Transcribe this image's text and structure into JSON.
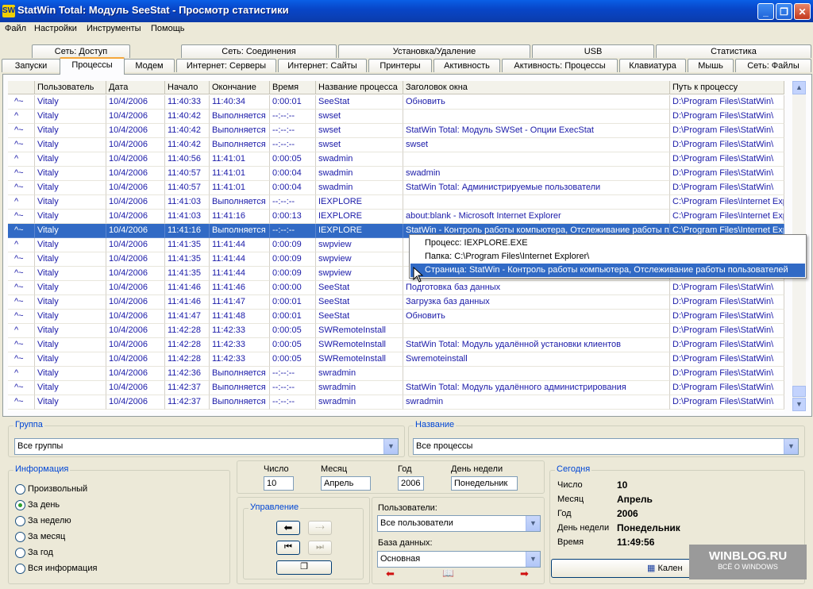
{
  "window": {
    "icon_text": "SW",
    "title": "StatWin Total: Модуль SeeStat - Просмотр статистики",
    "minimize": "_",
    "maximize": "❐",
    "close": "✕"
  },
  "menu": [
    "Файл",
    "Настройки",
    "Инструменты",
    "Помощь"
  ],
  "tabs_top": [
    "Сеть: Доступ",
    "Сеть: Соединения",
    "Установка/Удаление",
    "USB",
    "Статистика"
  ],
  "tabs_bottom": [
    "Запуски",
    "Процессы",
    "Модем",
    "Интернет: Серверы",
    "Интернет: Сайты",
    "Принтеры",
    "Активность",
    "Активность: Процессы",
    "Клавиатура",
    "Мышь",
    "Сеть: Файлы"
  ],
  "grid": {
    "columns": [
      "",
      "Пользователь",
      "Дата",
      "Начало",
      "Окончание",
      "Время",
      "Название процесса",
      "Заголовок окна",
      "Путь к процессу"
    ],
    "rows": [
      [
        "^~",
        "Vitaly",
        "10/4/2006",
        "11:40:33",
        "11:40:34",
        "0:00:01",
        "SeeStat",
        "Обновить",
        "D:\\Program Files\\StatWin\\"
      ],
      [
        "^",
        "Vitaly",
        "10/4/2006",
        "11:40:42",
        "Выполняется",
        "--:--:--",
        "swset",
        "",
        "D:\\Program Files\\StatWin\\"
      ],
      [
        "^~",
        "Vitaly",
        "10/4/2006",
        "11:40:42",
        "Выполняется",
        "--:--:--",
        "swset",
        "StatWin Total: Модуль SWSet - Опции ExecStat",
        "D:\\Program Files\\StatWin\\"
      ],
      [
        "^~",
        "Vitaly",
        "10/4/2006",
        "11:40:42",
        "Выполняется",
        "--:--:--",
        "swset",
        "swset",
        "D:\\Program Files\\StatWin\\"
      ],
      [
        "^",
        "Vitaly",
        "10/4/2006",
        "11:40:56",
        "11:41:01",
        "0:00:05",
        "swadmin",
        "",
        "D:\\Program Files\\StatWin\\"
      ],
      [
        "^~",
        "Vitaly",
        "10/4/2006",
        "11:40:57",
        "11:41:01",
        "0:00:04",
        "swadmin",
        "swadmin",
        "D:\\Program Files\\StatWin\\"
      ],
      [
        "^~",
        "Vitaly",
        "10/4/2006",
        "11:40:57",
        "11:41:01",
        "0:00:04",
        "swadmin",
        "StatWin Total: Администрируемые пользователи",
        "D:\\Program Files\\StatWin\\"
      ],
      [
        "^",
        "Vitaly",
        "10/4/2006",
        "11:41:03",
        "Выполняется",
        "--:--:--",
        "IEXPLORE",
        "",
        "C:\\Program Files\\Internet Expl"
      ],
      [
        "^~",
        "Vitaly",
        "10/4/2006",
        "11:41:03",
        "11:41:16",
        "0:00:13",
        "IEXPLORE",
        "about:blank - Microsoft Internet Explorer",
        "C:\\Program Files\\Internet Expl"
      ],
      [
        "^~",
        "Vitaly",
        "10/4/2006",
        "11:41:16",
        "Выполняется",
        "--:--:--",
        "IEXPLORE",
        "StatWin - Контроль работы компьютера, Отслеживание работы п",
        "C:\\Program Files\\Internet Expl"
      ],
      [
        "^",
        "Vitaly",
        "10/4/2006",
        "11:41:35",
        "11:41:44",
        "0:00:09",
        "swpview",
        "",
        "D:\\Program Files\\StatWin\\"
      ],
      [
        "^~",
        "Vitaly",
        "10/4/2006",
        "11:41:35",
        "11:41:44",
        "0:00:09",
        "swpview",
        "",
        "D:\\Program Files\\StatWin\\"
      ],
      [
        "^~",
        "Vitaly",
        "10/4/2006",
        "11:41:35",
        "11:41:44",
        "0:00:09",
        "swpview",
        "",
        "D:\\Program Files\\StatWin\\"
      ],
      [
        "^~",
        "Vitaly",
        "10/4/2006",
        "11:41:46",
        "11:41:46",
        "0:00:00",
        "SeeStat",
        "Подготовка баз данных",
        "D:\\Program Files\\StatWin\\"
      ],
      [
        "^~",
        "Vitaly",
        "10/4/2006",
        "11:41:46",
        "11:41:47",
        "0:00:01",
        "SeeStat",
        "Загрузка баз данных",
        "D:\\Program Files\\StatWin\\"
      ],
      [
        "^~",
        "Vitaly",
        "10/4/2006",
        "11:41:47",
        "11:41:48",
        "0:00:01",
        "SeeStat",
        "Обновить",
        "D:\\Program Files\\StatWin\\"
      ],
      [
        "^",
        "Vitaly",
        "10/4/2006",
        "11:42:28",
        "11:42:33",
        "0:00:05",
        "SWRemoteInstall",
        "",
        "D:\\Program Files\\StatWin\\"
      ],
      [
        "^~",
        "Vitaly",
        "10/4/2006",
        "11:42:28",
        "11:42:33",
        "0:00:05",
        "SWRemoteInstall",
        "StatWin Total: Модуль удалённой установки клиентов",
        "D:\\Program Files\\StatWin\\"
      ],
      [
        "^~",
        "Vitaly",
        "10/4/2006",
        "11:42:28",
        "11:42:33",
        "0:00:05",
        "SWRemoteInstall",
        "Swremoteinstall",
        "D:\\Program Files\\StatWin\\"
      ],
      [
        "^",
        "Vitaly",
        "10/4/2006",
        "11:42:36",
        "Выполняется",
        "--:--:--",
        "swradmin",
        "",
        "D:\\Program Files\\StatWin\\"
      ],
      [
        "^~",
        "Vitaly",
        "10/4/2006",
        "11:42:37",
        "Выполняется",
        "--:--:--",
        "swradmin",
        "StatWin Total: Модуль удалённого администрирования",
        "D:\\Program Files\\StatWin\\"
      ],
      [
        "^~",
        "Vitaly",
        "10/4/2006",
        "11:42:37",
        "Выполняется",
        "--:--:--",
        "swradmin",
        "swradmin",
        "D:\\Program Files\\StatWin\\"
      ]
    ],
    "selected_row": 9
  },
  "popup": {
    "process": "Процесс: IEXPLORE.EXE",
    "folder": "Папка: C:\\Program Files\\Internet Explorer\\",
    "page": "Страница: StatWin - Контроль работы компьютера, Отслеживание работы пользователей"
  },
  "group": {
    "label": "Группа",
    "value": "Все группы"
  },
  "name": {
    "label": "Название",
    "value": "Все процессы"
  },
  "info": {
    "label": "Информация",
    "options": [
      "Произвольный",
      "За день",
      "За неделю",
      "За месяц",
      "За год",
      "Вся информация"
    ],
    "selected": 1
  },
  "date_fields": {
    "day_label": "Число",
    "day_value": "10",
    "month_label": "Месяц",
    "month_value": "Апрель",
    "year_label": "Год",
    "year_value": "2006",
    "weekday_label": "День недели",
    "weekday_value": "Понедельник"
  },
  "control": {
    "label": "Управление"
  },
  "users": {
    "label": "Пользователи:",
    "value": "Все пользователи"
  },
  "database": {
    "label": "База данных:",
    "value": "Основная"
  },
  "today": {
    "label": "Сегодня",
    "day_label": "Число",
    "day_value": "10",
    "month_label": "Месяц",
    "month_value": "Апрель",
    "year_label": "Год",
    "year_value": "2006",
    "weekday_label": "День недели",
    "weekday_value": "Понедельник",
    "time_label": "Время",
    "time_value": "11:49:56"
  },
  "calendar_button": "Кален",
  "watermark": {
    "line1": "WINBLOG.RU",
    "line2": "ВСЁ О WINDOWS"
  }
}
